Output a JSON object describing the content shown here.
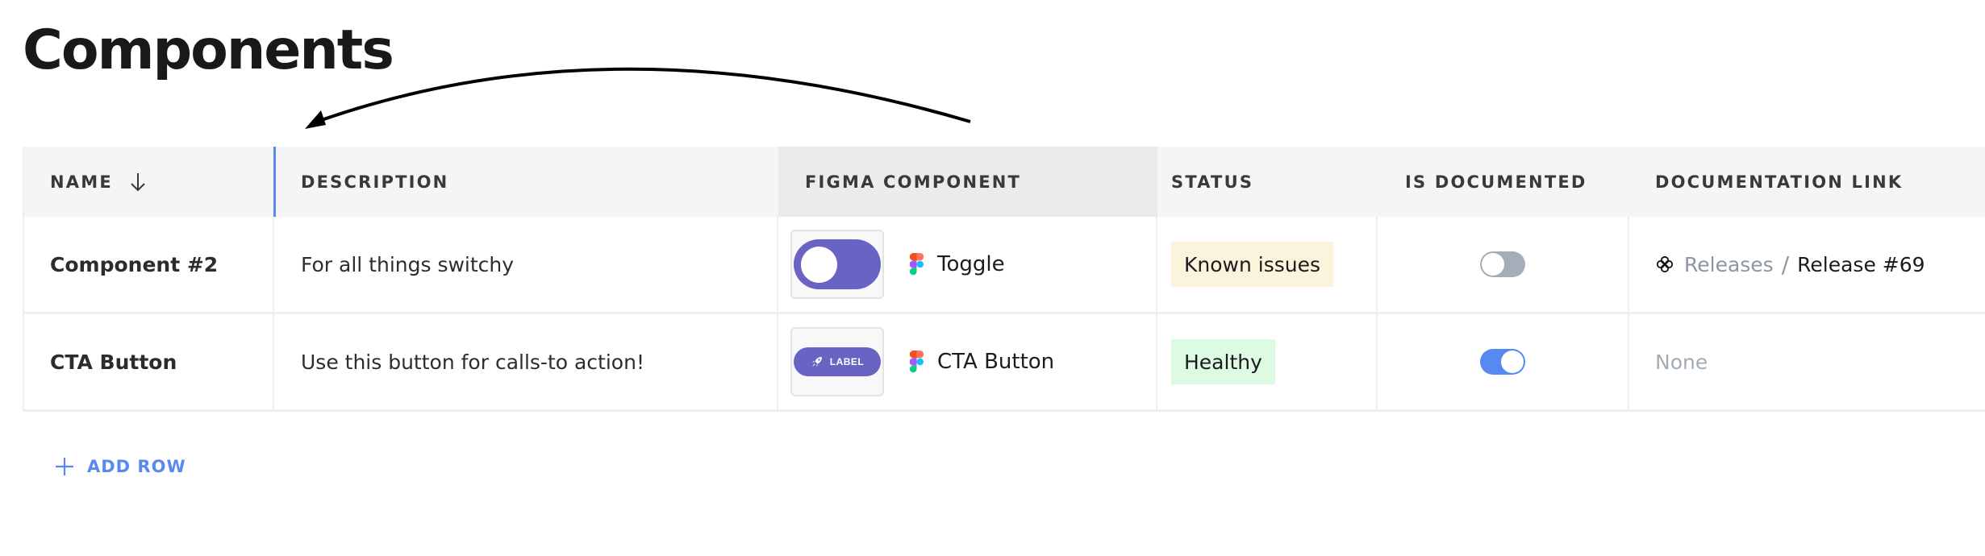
{
  "page": {
    "title": "Components"
  },
  "table": {
    "columns": [
      {
        "key": "name",
        "label": "NAME",
        "sort": "descending",
        "sort_icon": "arrow-down-icon"
      },
      {
        "key": "description",
        "label": "DESCRIPTION"
      },
      {
        "key": "figma_component",
        "label": "FIGMA COMPONENT"
      },
      {
        "key": "status",
        "label": "STATUS"
      },
      {
        "key": "is_documented",
        "label": "IS DOCUMENTED"
      },
      {
        "key": "documentation_link",
        "label": "DOCUMENTATION LINK"
      }
    ],
    "rows": [
      {
        "name": "Component #2",
        "description": "For all things switchy",
        "figma_component": {
          "preview": "toggle-preview",
          "icon": "figma-icon",
          "name": "Toggle"
        },
        "status": {
          "label": "Known issues",
          "color": "#FBF3DB"
        },
        "is_documented": false,
        "documentation_link": {
          "icon": "knot-icon",
          "parent": "Releases",
          "separator": "/",
          "current": "Release #69"
        }
      },
      {
        "name": "CTA Button",
        "description": "Use this button for calls-to action!",
        "figma_component": {
          "preview": "button-preview",
          "preview_label": "LABEL",
          "icon": "figma-icon",
          "name": "CTA Button"
        },
        "status": {
          "label": "Healthy",
          "color": "#DCFBE2"
        },
        "is_documented": true,
        "documentation_link": {
          "empty_text": "None"
        }
      }
    ]
  },
  "add_row": {
    "label": "ADD ROW",
    "icon": "plus-icon"
  },
  "colors": {
    "accent": "#5889F0",
    "component_purple": "#6964C4",
    "toggle_off": "#A5ADB8",
    "header_bg": "#F5F5F5",
    "header_highlight_bg": "#EBEBEB"
  }
}
